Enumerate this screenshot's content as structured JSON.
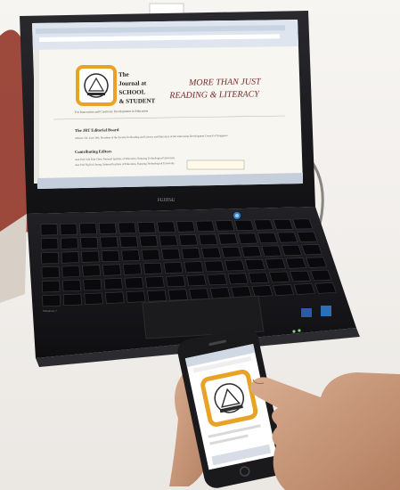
{
  "laptop_screen": {
    "journal_name_lines": [
      "The",
      "Journal at",
      "SCHOOL",
      "& STUDENT"
    ],
    "headline_lines": [
      "MORE THAN JUST",
      "READING & LITERACY"
    ],
    "tagline": "For Innovation and Creativity Development in Education",
    "editorial_board_heading": "The JRT Editorial Board",
    "editorial_board_text": "Advisor: Dr. Liaw Wei, President of the Society for Reading and Literacy and Education of the Universitas Development Council of Singapore",
    "contributing_heading": "Contributing Editors",
    "contributing_lines": [
      "Asst Prof Goh Kim Chee, National Institute of Education, Nanyang Technological University",
      "Asst Prof Ng Kok Seong, National Institute of Education, Nanyang Technological University"
    ]
  },
  "laptop": {
    "brand": "FUJITSU",
    "keyboard_brand": "Windows 7"
  },
  "colors": {
    "bezel": "#1c1c1f",
    "keyboard": "#131316",
    "screen_bg": "#f7f6f1",
    "browser_chrome": "#dfe5ee",
    "logo_border": "#e8a326",
    "headline": "#7a2a2a",
    "power_button": "#2f7fd1",
    "phone_body": "#1a1a1d",
    "skin": "#c79a7e"
  },
  "icons": [
    "journal-logo-icon",
    "power-button-icon",
    "windows-sticker-icon",
    "intel-sticker-icon"
  ]
}
